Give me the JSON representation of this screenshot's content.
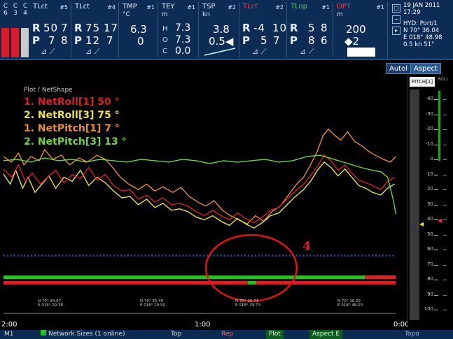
{
  "top": {
    "cells": [
      "C",
      "C",
      "C",
      "6",
      "3",
      "4"
    ],
    "panels": [
      {
        "title": "TLct",
        "num": "#5",
        "r": "50",
        "r2": "7",
        "p": "7",
        "p2": "8"
      },
      {
        "title": "TLct",
        "num": "#4",
        "r": "75",
        "r2": "17",
        "p": "12",
        "p2": "7"
      },
      {
        "title": "TMP",
        "num": "#1",
        "unit": "°C",
        "v1": "6.3",
        "v2": "0"
      },
      {
        "title": "TEY",
        "num": "#1",
        "unit": "m",
        "h": "7.3",
        "o": "7.3",
        "c": "0.0",
        "hl": "H",
        "ol": "O",
        "cl": "C"
      },
      {
        "title": "TSP",
        "num": "#2",
        "unit": "kn",
        "v1": "3.8",
        "v2": "0.5◀"
      },
      {
        "title": "TLct",
        "num": "#2",
        "r": "-4",
        "r2": "10",
        "p": "5",
        "p2": "7"
      },
      {
        "title": "TLop",
        "num": "#1",
        "r": "5",
        "r2": "8",
        "p": "8",
        "p2": "6"
      },
      {
        "title": "DPT",
        "num": "#1",
        "unit": "m",
        "v1": "200",
        "v2": "◆2"
      }
    ],
    "info": {
      "date": "19 JAN 2011",
      "time": "17:29",
      "hyd": "HYD: Port/1",
      "lat": "N  70° 36.04",
      "lon": "E 018° 48.98",
      "speed": "0.5 kn   51°"
    }
  },
  "tabs": {
    "autol": "Autol",
    "aspect": "Aspect"
  },
  "scale": {
    "header": "PITCH[1]",
    "roll": "ROLL",
    "ticks": [
      "-40",
      "-30",
      "-20",
      "-10",
      "0",
      "10",
      "20",
      "30",
      "40",
      "50",
      "60",
      "70",
      "80",
      "90",
      "100"
    ]
  },
  "legend": {
    "header": "Plot / NetShape",
    "items": [
      {
        "text": "1. NetRoll[1] 50 °",
        "color": "#d8202a"
      },
      {
        "text": "2. NetRoll[3] 75 °",
        "color": "#f0e34a"
      },
      {
        "text": "1. NetPitch[1] 7 °",
        "color": "#e8903a"
      },
      {
        "text": "2. NetPitch[3] 13 °",
        "color": "#73d63d"
      }
    ]
  },
  "annotation": {
    "label": "4"
  },
  "time_axis": {
    "left": "2:00",
    "mid": "1:00",
    "right": "0:00"
  },
  "positions": [
    {
      "lat": "N  70° 34.67",
      "lon": "E 018° 29.38"
    },
    {
      "lat": "N  70° 35.49",
      "lon": "E 018° 29.50"
    },
    {
      "lat": "N  70° 35.71",
      "lon": "E 018° 39.73"
    },
    {
      "lat": "N  70° 36.22",
      "lon": "E 018° 48.50"
    }
  ],
  "bottom": {
    "m1": "M1",
    "network": "Network Sizes (1 online)",
    "top": "Top",
    "rep": "Rep",
    "plot": "Plot",
    "aspect_e": "Aspect E",
    "extra": "Topo"
  },
  "colors": {
    "topbar": "#0c2c55",
    "accent": "#1b4f86",
    "red": "#d8202a",
    "green": "#27c21f",
    "yellow": "#f0e34a",
    "orange": "#e8903a"
  }
}
